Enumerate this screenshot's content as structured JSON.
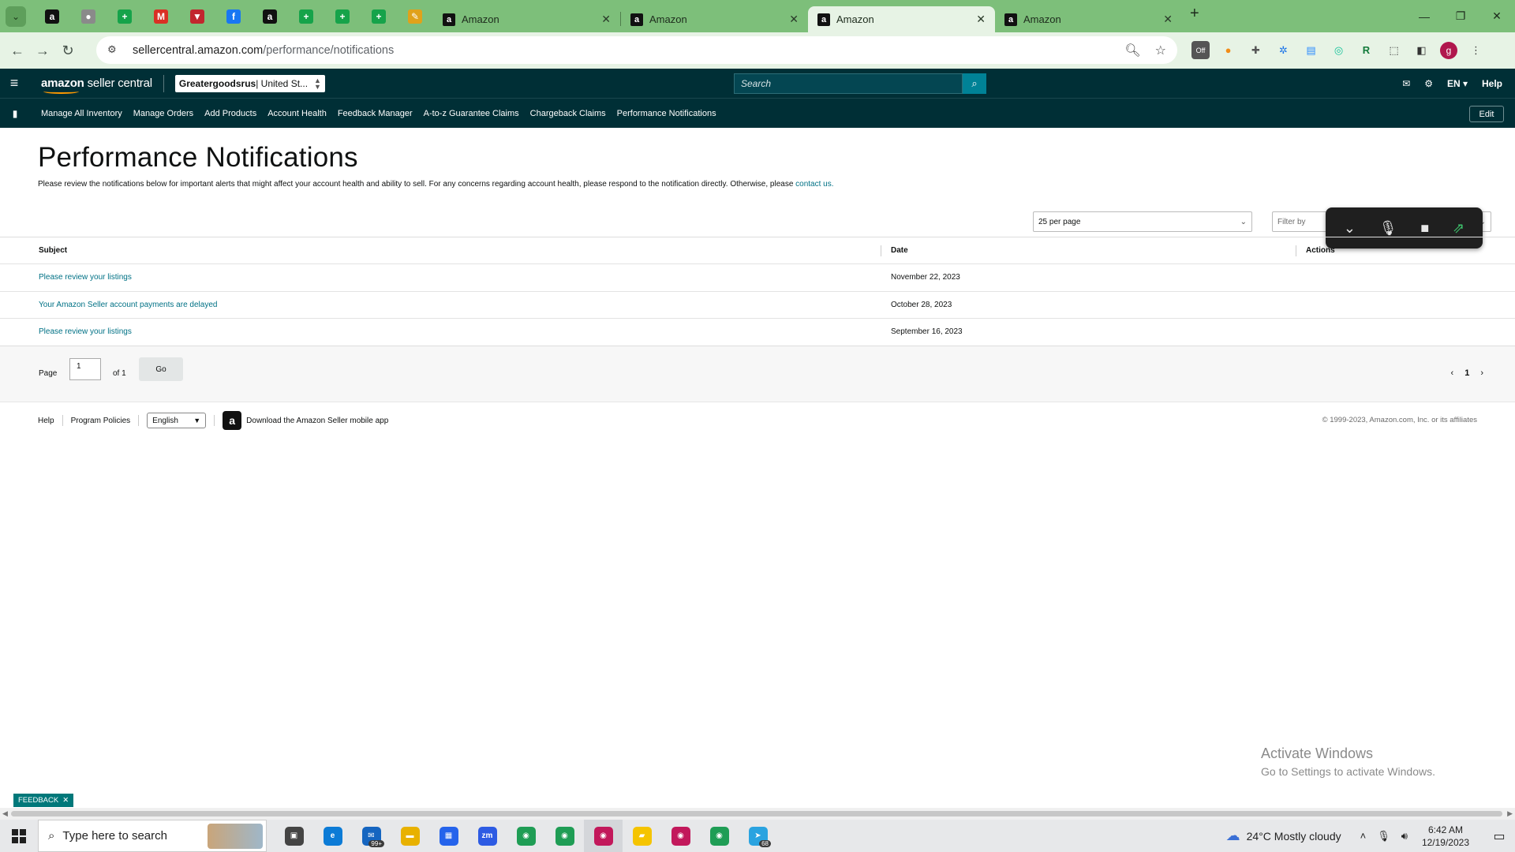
{
  "browser": {
    "pinned_tabs": [
      {
        "icon": "amazon-icon",
        "color": "#111111",
        "glyph": "a"
      },
      {
        "icon": "globe-icon",
        "color": "#8a8a8a",
        "glyph": "●"
      },
      {
        "icon": "sheets-icon",
        "color": "#16a34a",
        "glyph": "+"
      },
      {
        "icon": "gmail-icon",
        "color": "#d93025",
        "glyph": "M"
      },
      {
        "icon": "shield-icon",
        "color": "#c2262e",
        "glyph": "▼"
      },
      {
        "icon": "facebook-icon",
        "color": "#1877f2",
        "glyph": "f"
      },
      {
        "icon": "amazon-icon",
        "color": "#111111",
        "glyph": "a"
      },
      {
        "icon": "sheets-icon",
        "color": "#16a34a",
        "glyph": "+"
      },
      {
        "icon": "sheets-icon",
        "color": "#16a34a",
        "glyph": "+"
      },
      {
        "icon": "sheets-icon",
        "color": "#16a34a",
        "glyph": "+"
      },
      {
        "icon": "pencil-icon",
        "color": "#e0a21a",
        "glyph": "✎"
      }
    ],
    "tabs": [
      {
        "title": "Amazon",
        "active": false
      },
      {
        "title": "Amazon",
        "active": false
      },
      {
        "title": "Amazon",
        "active": true
      },
      {
        "title": "Amazon",
        "active": false
      }
    ],
    "url_host": "sellercentral.amazon.com",
    "url_path": "/performance/notifications",
    "profile_initial": "g"
  },
  "header": {
    "logo_a": "amazon",
    "logo_b": "seller central",
    "account_bold": "Greatergoodsrus",
    "account_rest": " | United St...",
    "search_placeholder": "Search",
    "language": "EN",
    "help": "Help"
  },
  "nav": {
    "items": [
      "Manage All Inventory",
      "Manage Orders",
      "Add Products",
      "Account Health",
      "Feedback Manager",
      "A-to-z Guarantee Claims",
      "Chargeback Claims",
      "Performance Notifications"
    ],
    "edit_label": "Edit"
  },
  "main": {
    "title": "Performance Notifications",
    "intro": "Please review the notifications below for important alerts that might affect your account health and ability to sell. For any concerns regarding account health, please respond to the notification directly. Otherwise, please ",
    "intro_link": "contact us.",
    "per_page": "25 per page",
    "filter_placeholder": "Filter by"
  },
  "table": {
    "headers": {
      "subject": "Subject",
      "date": "Date",
      "actions": "Actions"
    },
    "rows": [
      {
        "subject": "Please review your listings",
        "date": "November 22, 2023"
      },
      {
        "subject": "Your Amazon Seller account payments are delayed",
        "date": "October 28, 2023"
      },
      {
        "subject": "Please review your listings",
        "date": "September 16, 2023"
      }
    ]
  },
  "pagination": {
    "page_label": "Page",
    "page_value": "1",
    "of_label": "of 1",
    "go_label": "Go",
    "current": "1"
  },
  "footer": {
    "help": "Help",
    "program_policies": "Program Policies",
    "language": "English",
    "app_text": "Download the Amazon Seller mobile app",
    "copyright": "© 1999-2023, Amazon.com, Inc. or its affiliates"
  },
  "feedback_label": "FEEDBACK",
  "watermark": {
    "line1": "Activate Windows",
    "line2": "Go to Settings to activate Windows."
  },
  "taskbar": {
    "search_placeholder": "Type here to search",
    "apps": [
      {
        "name": "task-view-icon",
        "color": "#444444",
        "glyph": "▣",
        "badge": ""
      },
      {
        "name": "edge-icon",
        "color": "#0c7bd6",
        "glyph": "e",
        "badge": ""
      },
      {
        "name": "mail-icon",
        "color": "#1565c0",
        "glyph": "✉",
        "badge": "99+"
      },
      {
        "name": "file-explorer-icon",
        "color": "#e8b100",
        "glyph": "▬",
        "badge": ""
      },
      {
        "name": "store-icon",
        "color": "#2563eb",
        "glyph": "▦",
        "badge": ""
      },
      {
        "name": "zoom-icon",
        "color": "#2d5be3",
        "glyph": "zm",
        "badge": ""
      },
      {
        "name": "chrome-icon",
        "color": "#1f9d55",
        "glyph": "◉",
        "badge": ""
      },
      {
        "name": "chrome-icon",
        "color": "#1f9d55",
        "glyph": "◉",
        "badge": ""
      },
      {
        "name": "chrome-icon",
        "color": "#c2185b",
        "glyph": "◉",
        "badge": ""
      },
      {
        "name": "sticky-notes-icon",
        "color": "#f5c400",
        "glyph": "▰",
        "badge": ""
      },
      {
        "name": "chrome-icon",
        "color": "#c2185b",
        "glyph": "◉",
        "badge": ""
      },
      {
        "name": "chrome-icon",
        "color": "#1f9d55",
        "glyph": "◉",
        "badge": ""
      },
      {
        "name": "telegram-icon",
        "color": "#2aa3e0",
        "glyph": "➤",
        "badge": "68"
      }
    ],
    "weather": "24°C  Mostly cloudy",
    "time": "6:42 AM",
    "date": "12/19/2023"
  },
  "colors": {
    "tabstrip": "#7dbf7a",
    "amazon_header": "#002f36",
    "link": "#007185",
    "search_button": "#008296"
  }
}
